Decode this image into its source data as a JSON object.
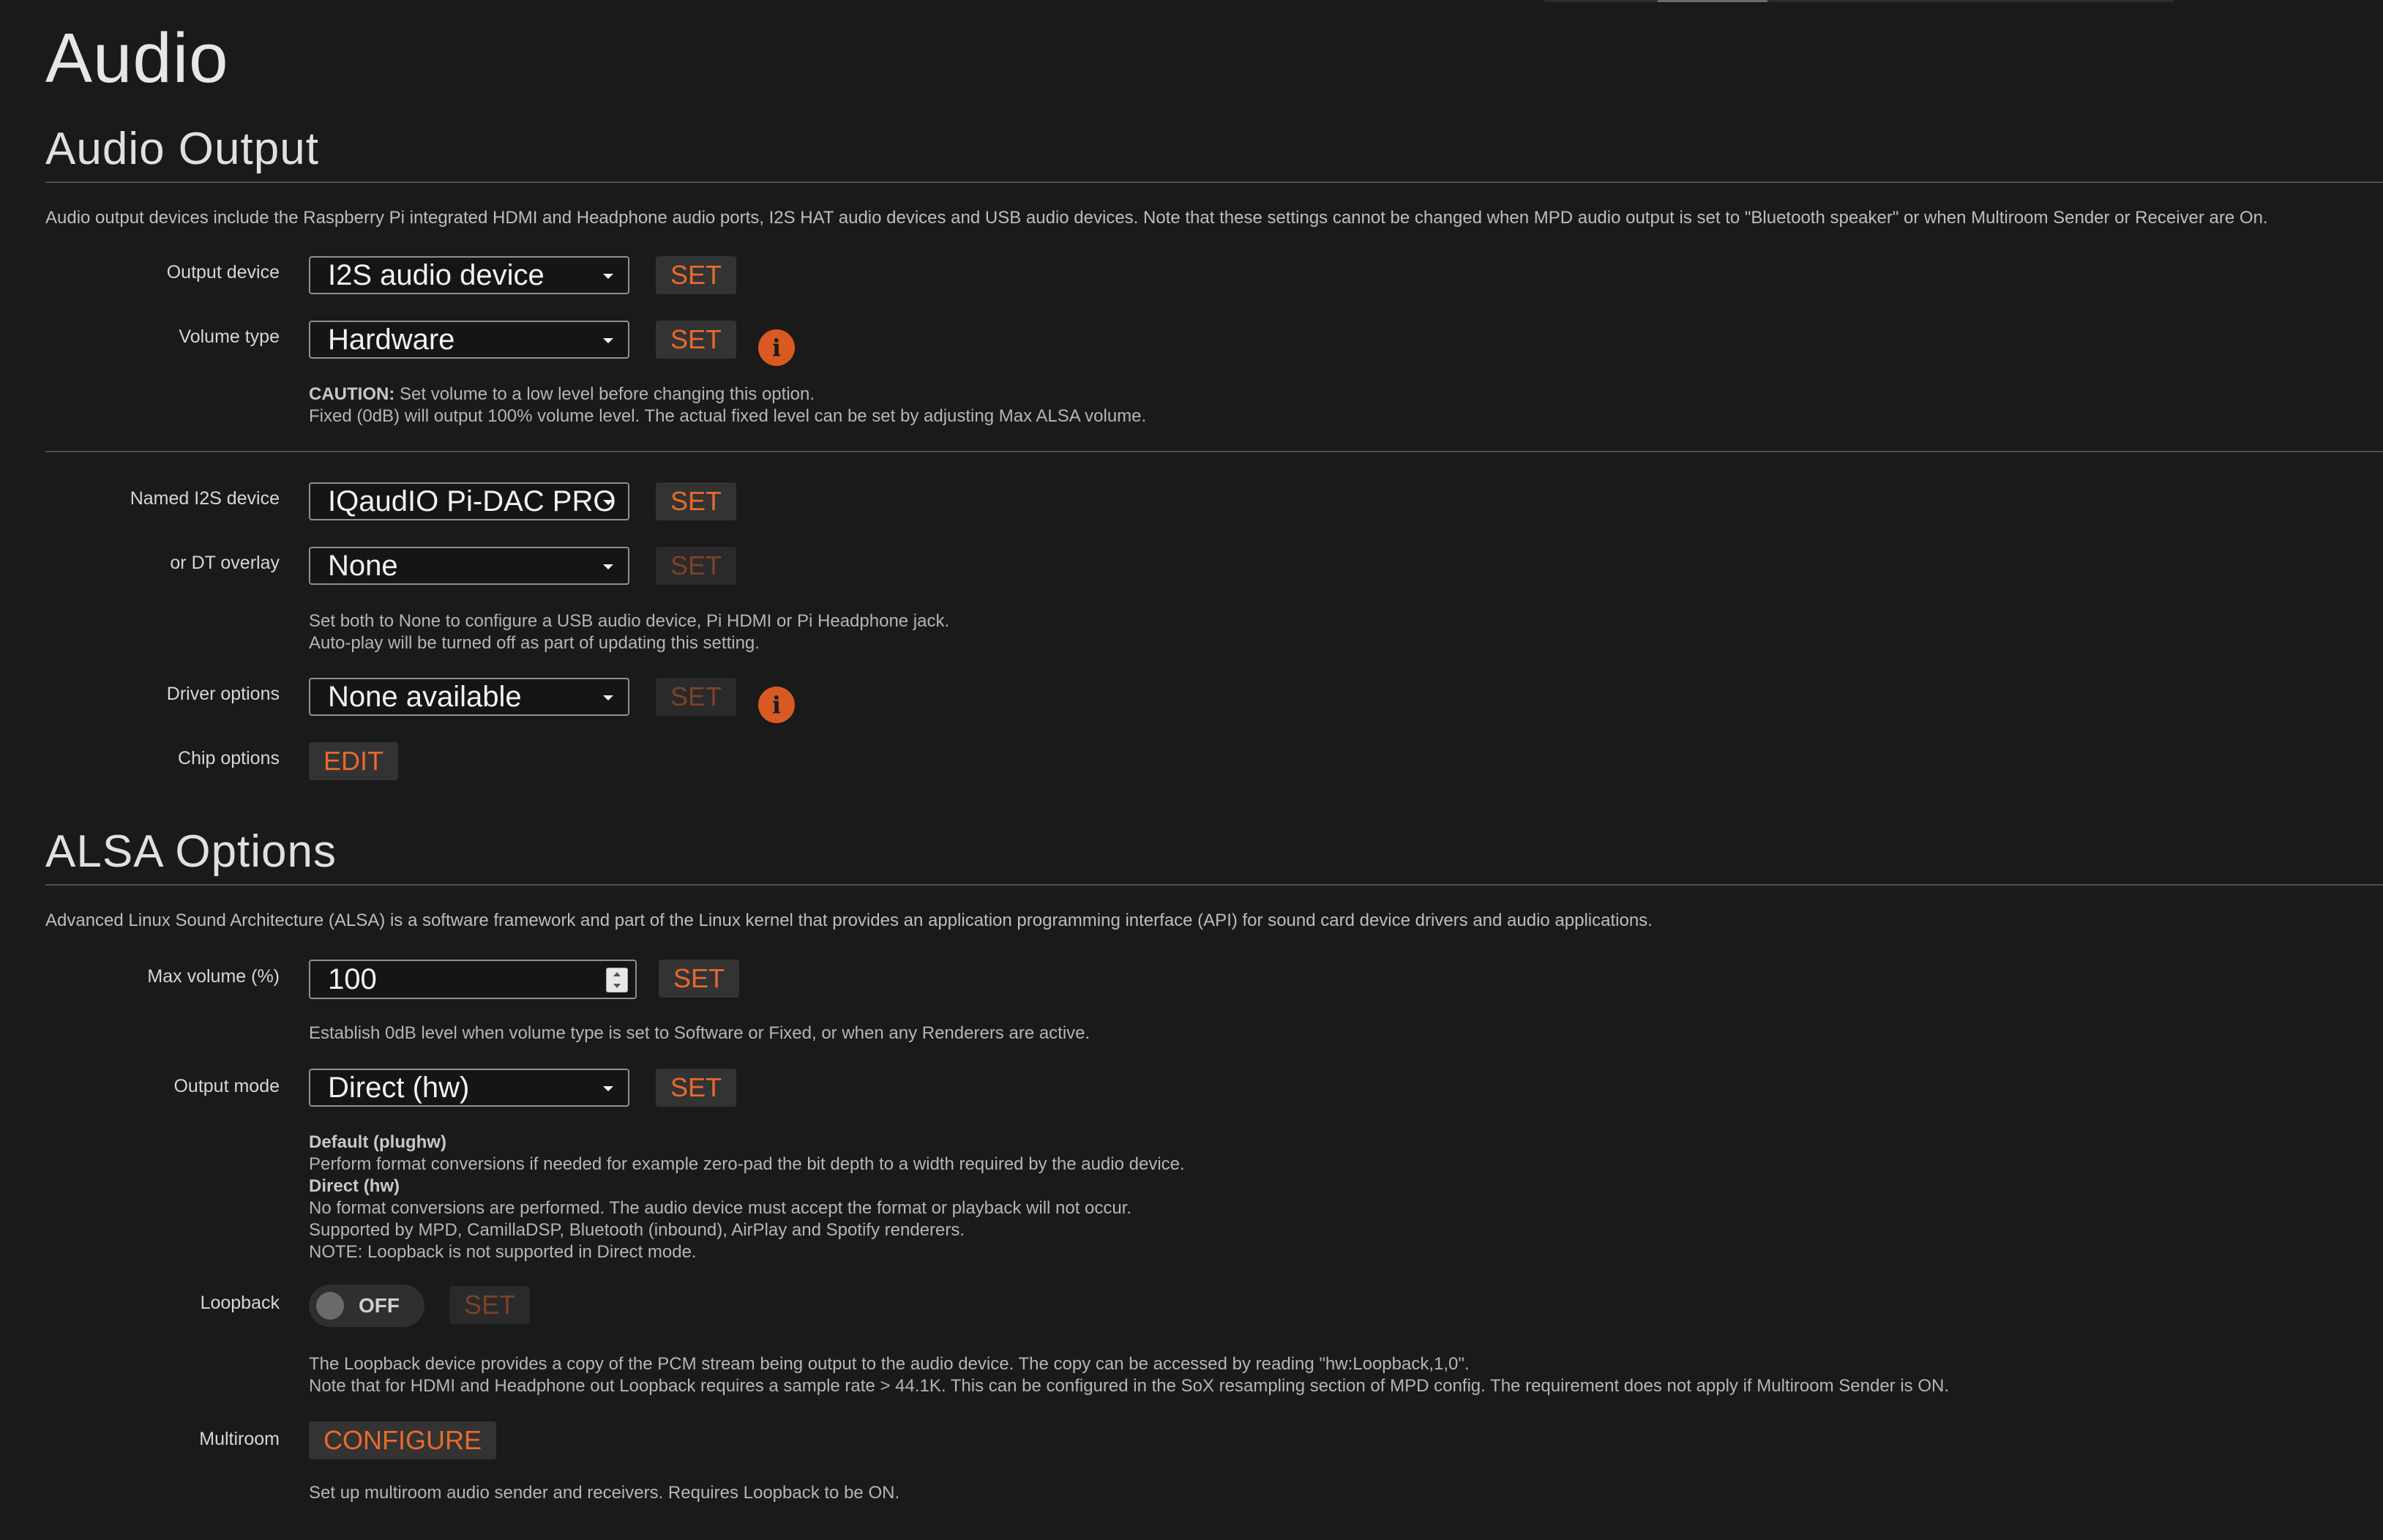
{
  "page": {
    "title": "Audio"
  },
  "audio_output": {
    "title": "Audio Output",
    "description": "Audio output devices include the Raspberry Pi integrated HDMI and Headphone audio ports, I2S HAT audio devices and USB audio devices. Note that these settings cannot be changed when MPD audio output is set to \"Bluetooth speaker\" or when Multiroom Sender or Receiver are On.",
    "output_device": {
      "label": "Output device",
      "value": "I2S audio device",
      "set_label": "SET"
    },
    "volume_type": {
      "label": "Volume type",
      "value": "Hardware",
      "set_label": "SET",
      "info_glyph": "i",
      "help_caution_bold": "CAUTION:",
      "help_caution_text": " Set volume to a low level before changing this option.",
      "help_line2": "Fixed (0dB) will output 100% volume level. The actual fixed level can be set by adjusting Max ALSA volume."
    },
    "named_i2s": {
      "label": "Named I2S device",
      "value": "IQaudIO Pi-DAC PRO",
      "set_label": "SET"
    },
    "dt_overlay": {
      "label": "or DT overlay",
      "value": "None",
      "set_label": "SET",
      "help_line1": "Set both to None to configure a USB audio device, Pi HDMI or Pi Headphone jack.",
      "help_line2": "Auto-play will be turned off as part of updating this setting."
    },
    "driver_options": {
      "label": "Driver options",
      "value": "None available",
      "set_label": "SET",
      "info_glyph": "i"
    },
    "chip_options": {
      "label": "Chip options",
      "edit_label": "EDIT"
    }
  },
  "alsa": {
    "title": "ALSA Options",
    "description": "Advanced Linux Sound Architecture (ALSA) is a software framework and part of the Linux kernel that provides an application programming interface (API) for sound card device drivers and audio applications.",
    "max_volume": {
      "label": "Max volume (%)",
      "value": "100",
      "set_label": "SET",
      "help": "Establish 0dB level when volume type is set to Software or Fixed, or when any Renderers are active."
    },
    "output_mode": {
      "label": "Output mode",
      "value": "Direct (hw)",
      "set_label": "SET",
      "help_h1": "Default (plughw)",
      "help_l1": "Perform format conversions if needed for example zero-pad the bit depth to a width required by the audio device.",
      "help_h2": "Direct (hw)",
      "help_l2": "No format conversions are performed. The audio device must accept the format or playback will not occur.",
      "help_l3": "Supported by MPD, CamillaDSP, Bluetooth (inbound), AirPlay and Spotify renderers.",
      "help_l4": "NOTE: Loopback is not supported in Direct mode."
    },
    "loopback": {
      "label": "Loopback",
      "toggle_state": "OFF",
      "set_label": "SET",
      "help_line1": "The Loopback device provides a copy of the PCM stream being output to the audio device. The copy can be accessed by reading \"hw:Loopback,1,0\".",
      "help_line2": "Note that for HDMI and Headphone out Loopback requires a sample rate > 44.1K. This can be configured in the SoX resampling section of MPD config. The requirement does not apply if Multiroom Sender is ON."
    },
    "multiroom": {
      "label": "Multiroom",
      "configure_label": "CONFIGURE",
      "help": "Set up multiroom audio sender and receivers. Requires Loopback to be ON."
    }
  },
  "colors": {
    "accent": "#e86a2c",
    "background": "#1a1a1a",
    "button_bg": "#333333",
    "info": "#d85a22"
  }
}
